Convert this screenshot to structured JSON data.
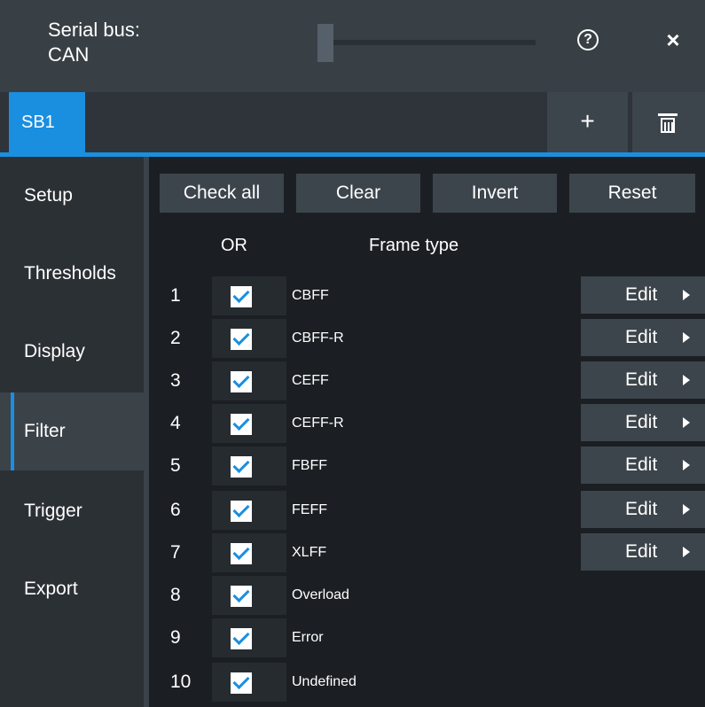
{
  "header": {
    "title_line1": "Serial bus:",
    "title_line2": "CAN",
    "help_glyph": "?",
    "close_glyph": "×",
    "help_icon": "help-circle-icon",
    "close_icon": "close-icon"
  },
  "tabs": {
    "active_label": "SB1",
    "add_glyph": "+",
    "add_icon": "plus-icon",
    "delete_icon": "trash-icon"
  },
  "sidebar": {
    "items": [
      {
        "label": "Setup"
      },
      {
        "label": "Thresholds"
      },
      {
        "label": "Display"
      },
      {
        "label": "Filter",
        "active": true
      },
      {
        "label": "Trigger"
      },
      {
        "label": "Export"
      }
    ]
  },
  "toolbar": {
    "check_all": "Check all",
    "clear": "Clear",
    "invert": "Invert",
    "reset": "Reset"
  },
  "table": {
    "col_or": "OR",
    "col_frame_type": "Frame type",
    "edit_label": "Edit",
    "rows": [
      {
        "num": "1",
        "name": "CBFF",
        "checked": true,
        "editable": true
      },
      {
        "num": "2",
        "name": "CBFF-R",
        "checked": true,
        "editable": true
      },
      {
        "num": "3",
        "name": "CEFF",
        "checked": true,
        "editable": true
      },
      {
        "num": "4",
        "name": "CEFF-R",
        "checked": true,
        "editable": true
      },
      {
        "num": "5",
        "name": "FBFF",
        "checked": true,
        "editable": true
      },
      {
        "num": "6",
        "name": "FEFF",
        "checked": true,
        "editable": true
      },
      {
        "num": "7",
        "name": "XLFF",
        "checked": true,
        "editable": true
      },
      {
        "num": "8",
        "name": "Overload",
        "checked": true,
        "editable": false
      },
      {
        "num": "9",
        "name": "Error",
        "checked": true,
        "editable": false
      },
      {
        "num": "10",
        "name": "Undefined",
        "checked": true,
        "editable": false
      }
    ]
  },
  "colors": {
    "accent": "#1a8fe0",
    "background": "#1b1f23",
    "header": "#394045",
    "button": "#3d454c"
  }
}
